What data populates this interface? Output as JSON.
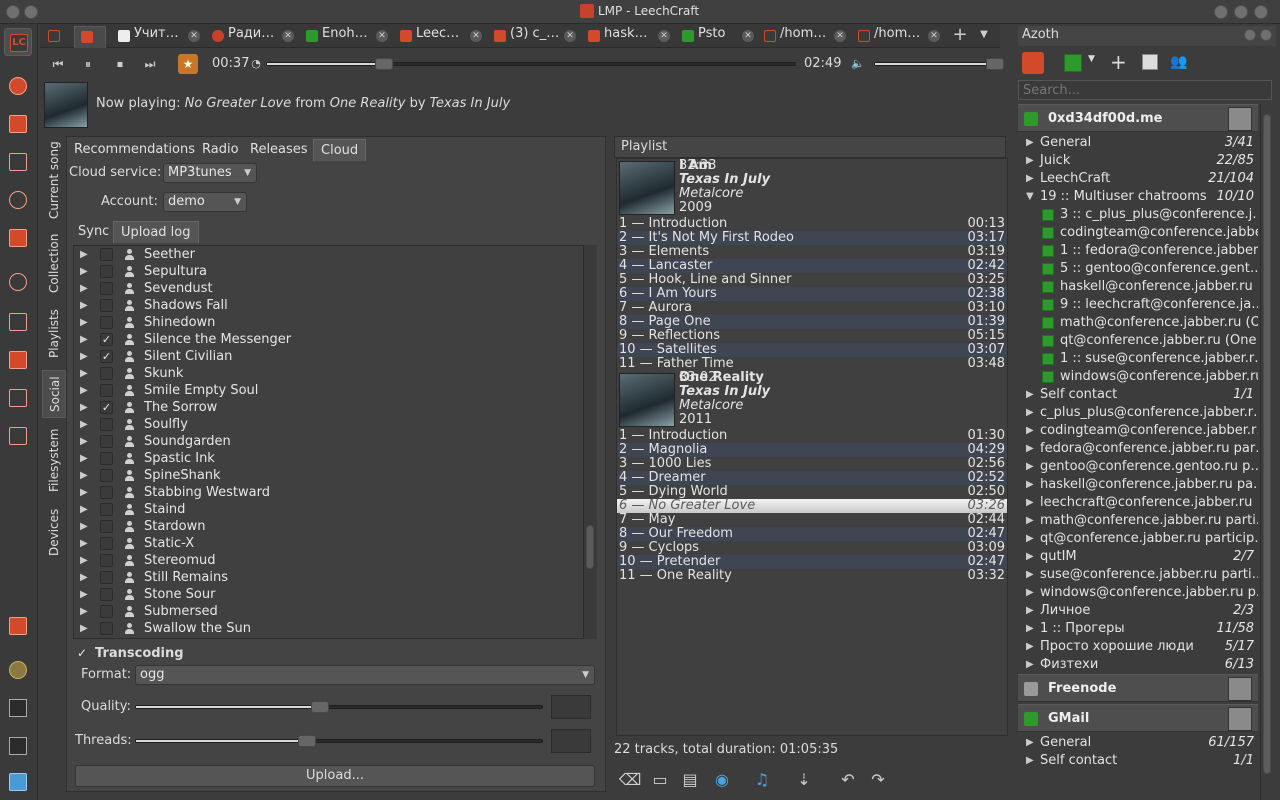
{
  "window": {
    "title": "LMP - LeechCraft"
  },
  "tabs": [
    {
      "label": "",
      "icon": "lc-icon",
      "color": "#d34a2a"
    },
    {
      "label": "",
      "icon": "lmp-icon",
      "color": "#d34a2a"
    },
    {
      "label": "Учит…",
      "icon": "lf-icon",
      "color": "#eeeeee"
    },
    {
      "label": "Ради…",
      "icon": "radio-icon",
      "color": "#c8412a"
    },
    {
      "label": "Enoh…",
      "icon": "green-status-icon",
      "color": "#2e9a2e"
    },
    {
      "label": "Leec…",
      "icon": "lc-icon",
      "color": "#d34a2a"
    },
    {
      "label": "(3) c_…",
      "icon": "chat-icon",
      "color": "#d34a2a"
    },
    {
      "label": "hask…",
      "icon": "chat-icon",
      "color": "#d34a2a"
    },
    {
      "label": "Psto",
      "icon": "green-status-icon",
      "color": "#2e9a2e"
    },
    {
      "label": "/hom…",
      "icon": "edit-icon",
      "color": "#d34a2a"
    },
    {
      "label": "/hom…",
      "icon": "edit-icon",
      "color": "#d34a2a"
    }
  ],
  "player": {
    "elapsed": "00:37",
    "total": "02:49",
    "progress": 0.22,
    "volume": 0.95
  },
  "now_playing": {
    "prefix": "Now playing:",
    "track": "No Greater Love",
    "from": "from",
    "album": "One Reality",
    "by": "by",
    "artist": "Texas In July"
  },
  "vertical_tabs": [
    "Current song",
    "Collection",
    "Playlists",
    "Social",
    "Filesystem",
    "Devices"
  ],
  "cloud": {
    "tabs": [
      "Recommendations",
      "Radio",
      "Releases",
      "Cloud"
    ],
    "service_label": "Cloud service:",
    "service_value": "MP3tunes",
    "account_label": "Account:",
    "account_value": "demo",
    "subtabs": [
      "Sync",
      "Upload log"
    ],
    "artists": [
      {
        "name": "Seether",
        "checked": false
      },
      {
        "name": "Sepultura",
        "checked": false
      },
      {
        "name": "Sevendust",
        "checked": false
      },
      {
        "name": "Shadows Fall",
        "checked": false
      },
      {
        "name": "Shinedown",
        "checked": false
      },
      {
        "name": "Silence the Messenger",
        "checked": true
      },
      {
        "name": "Silent Civilian",
        "checked": true
      },
      {
        "name": "Skunk",
        "checked": false
      },
      {
        "name": "Smile Empty Soul",
        "checked": false
      },
      {
        "name": "The Sorrow",
        "checked": true
      },
      {
        "name": "Soulfly",
        "checked": false
      },
      {
        "name": "Soundgarden",
        "checked": false
      },
      {
        "name": "Spastic Ink",
        "checked": false
      },
      {
        "name": "SpineShank",
        "checked": false
      },
      {
        "name": "Stabbing Westward",
        "checked": false
      },
      {
        "name": "Staind",
        "checked": false
      },
      {
        "name": "Stardown",
        "checked": false
      },
      {
        "name": "Static-X",
        "checked": false
      },
      {
        "name": "Stereomud",
        "checked": false
      },
      {
        "name": "Still Remains",
        "checked": false
      },
      {
        "name": "Stone Sour",
        "checked": false
      },
      {
        "name": "Submersed",
        "checked": false
      },
      {
        "name": "Swallow the Sun",
        "checked": false
      }
    ],
    "transcoding_label": "Transcoding",
    "format_label": "Format:",
    "format_value": "ogg",
    "quality_label": "Quality:",
    "quality_value": 0.45,
    "threads_label": "Threads:",
    "threads_value": 0.42,
    "upload_button": "Upload..."
  },
  "playlist": {
    "header": "Playlist",
    "albums": [
      {
        "title": "I Am",
        "artist": "Texas In July",
        "genre": "Metalcore",
        "year": "2009",
        "length": "32:33",
        "tracks": [
          [
            "1 — Introduction",
            "00:13"
          ],
          [
            "2 — It's Not My First Rodeo",
            "03:17"
          ],
          [
            "3 — Elements",
            "03:19"
          ],
          [
            "4 — Lancaster",
            "02:42"
          ],
          [
            "5 — Hook, Line and Sinner",
            "03:25"
          ],
          [
            "6 — I Am Yours",
            "02:38"
          ],
          [
            "7 — Aurora",
            "03:10"
          ],
          [
            "8 — Page One",
            "01:39"
          ],
          [
            "9 — Reflections",
            "05:15"
          ],
          [
            "10 — Satellites",
            "03:07"
          ],
          [
            "11 — Father Time",
            "03:48"
          ]
        ]
      },
      {
        "title": "One Reality",
        "artist": "Texas In July",
        "genre": "Metalcore",
        "year": "2011",
        "length": "33:02",
        "tracks": [
          [
            "1 — Introduction",
            "01:30"
          ],
          [
            "2 — Magnolia",
            "04:29"
          ],
          [
            "3 — 1000 Lies",
            "02:56"
          ],
          [
            "4 — Dreamer",
            "02:52"
          ],
          [
            "5 — Dying World",
            "02:50"
          ],
          [
            "6 — No Greater Love",
            "03:26"
          ],
          [
            "7 — May",
            "02:44"
          ],
          [
            "8 — Our Freedom",
            "02:47"
          ],
          [
            "9 — Cyclops",
            "03:09"
          ],
          [
            "10 — Pretender",
            "02:47"
          ],
          [
            "11 — One Reality",
            "03:32"
          ]
        ]
      }
    ],
    "current_album": 1,
    "current_track": 5,
    "summary": "22 tracks, total duration: 01:05:35"
  },
  "azoth": {
    "title": "Azoth",
    "search_placeholder": "Search...",
    "accounts": [
      {
        "name": "0xd34df00d.me",
        "status_color": "#2e9a2e",
        "rows": [
          {
            "type": "group",
            "name": "General",
            "count": "3/41"
          },
          {
            "type": "group",
            "name": "Juick",
            "count": "22/85"
          },
          {
            "type": "group",
            "name": "LeechCraft",
            "count": "21/104"
          },
          {
            "type": "group-open",
            "name": "19 :: Multiuser chatrooms",
            "count": "10/10"
          },
          {
            "type": "contact",
            "name": "3 :: c_plus_plus@conference.j…"
          },
          {
            "type": "contact",
            "name": "codingteam@conference.jabbe…"
          },
          {
            "type": "contact",
            "name": "1 :: fedora@conference.jabber…"
          },
          {
            "type": "contact",
            "name": "5 :: gentoo@conference.gent…"
          },
          {
            "type": "contact",
            "name": "haskell@conference.jabber.ru (…"
          },
          {
            "type": "contact",
            "name": "9 :: leechcraft@conference.ja…"
          },
          {
            "type": "contact",
            "name": "math@conference.jabber.ru (O…"
          },
          {
            "type": "contact",
            "name": "qt@conference.jabber.ru (One …"
          },
          {
            "type": "contact",
            "name": "1 :: suse@conference.jabber.r…"
          },
          {
            "type": "contact",
            "name": "windows@conference.jabber.ru…"
          },
          {
            "type": "group",
            "name": "Self contact",
            "count": "1/1"
          },
          {
            "type": "group",
            "name": "c_plus_plus@conference.jabber.r…",
            "count": ""
          },
          {
            "type": "group",
            "name": "codingteam@conference.jabber.r…",
            "count": ""
          },
          {
            "type": "group",
            "name": "fedora@conference.jabber.ru par…",
            "count": ""
          },
          {
            "type": "group",
            "name": "gentoo@conference.gentoo.ru p…",
            "count": ""
          },
          {
            "type": "group",
            "name": "haskell@conference.jabber.ru pa…",
            "count": ""
          },
          {
            "type": "group",
            "name": "leechcraft@conference.jabber.ru …",
            "count": ""
          },
          {
            "type": "group",
            "name": "math@conference.jabber.ru parti…",
            "count": ""
          },
          {
            "type": "group",
            "name": "qt@conference.jabber.ru particip…",
            "count": ""
          },
          {
            "type": "group",
            "name": "qutIM",
            "count": "2/7"
          },
          {
            "type": "group",
            "name": "suse@conference.jabber.ru parti…",
            "count": ""
          },
          {
            "type": "group",
            "name": "windows@conference.jabber.ru p…",
            "count": ""
          },
          {
            "type": "group",
            "name": "Личное",
            "count": "2/3"
          },
          {
            "type": "group",
            "name": "1 :: Прогеры",
            "count": "11/58"
          },
          {
            "type": "group",
            "name": "Просто хорошие люди",
            "count": "5/17"
          },
          {
            "type": "group",
            "name": "Физтехи",
            "count": "6/13"
          }
        ]
      },
      {
        "name": "Freenode",
        "status_color": "#9a9a9a",
        "rows": []
      },
      {
        "name": "GMail",
        "status_color": "#2e9a2e",
        "rows": [
          {
            "type": "group",
            "name": "General",
            "count": "61/157"
          },
          {
            "type": "group",
            "name": "Self contact",
            "count": "1/1"
          }
        ]
      }
    ]
  }
}
